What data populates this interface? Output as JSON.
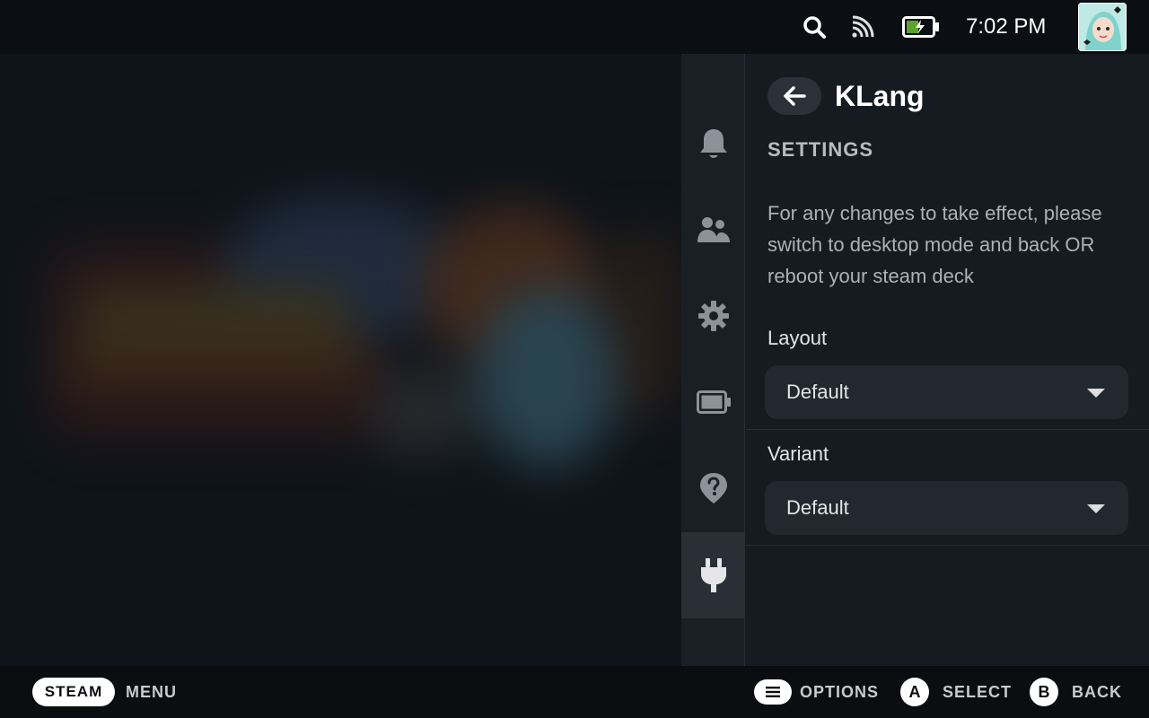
{
  "status_bar": {
    "time": "7:02 PM",
    "icons": [
      "search-icon",
      "cast-icon",
      "battery-charging-icon",
      "avatar"
    ]
  },
  "sidebar": {
    "tabs": [
      {
        "id": "notifications",
        "icon": "bell-icon"
      },
      {
        "id": "friends",
        "icon": "friends-icon"
      },
      {
        "id": "settings",
        "icon": "gear-icon"
      },
      {
        "id": "performance",
        "icon": "battery-icon"
      },
      {
        "id": "help",
        "icon": "help-icon"
      },
      {
        "id": "plugins",
        "icon": "plug-icon",
        "active": true
      }
    ]
  },
  "plugin": {
    "title": "KLang",
    "section_heading": "SETTINGS",
    "notice": "For any changes to take effect, please switch to desktop mode and back OR reboot your steam deck",
    "fields": {
      "layout": {
        "label": "Layout",
        "value": "Default"
      },
      "variant": {
        "label": "Variant",
        "value": "Default"
      }
    }
  },
  "footer": {
    "steam_label": "STEAM",
    "menu_label": "MENU",
    "options_label": "OPTIONS",
    "a_glyph": "A",
    "select_label": "SELECT",
    "b_glyph": "B",
    "back_label": "BACK"
  },
  "colors": {
    "panel_bg": "#161a21",
    "dropdown_bg": "#23272f",
    "accent_battery": "#5ba32b",
    "text_primary": "#ffffff"
  }
}
